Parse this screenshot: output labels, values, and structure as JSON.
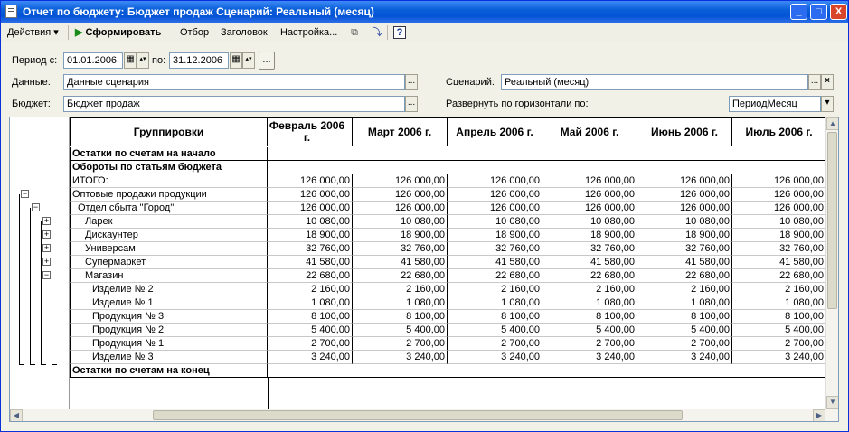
{
  "window": {
    "title": "Отчет по бюджету: Бюджет продаж Сценарий: Реальный (месяц)",
    "minimize": "_",
    "maximize": "□",
    "close": "X"
  },
  "toolbar": {
    "actions": "Действия",
    "generate": "Сформировать",
    "selection": "Отбор",
    "header": "Заголовок",
    "settings": "Настройка...",
    "help": "?"
  },
  "filters": {
    "period_from_label": "Период с:",
    "period_from": "01.01.2006",
    "period_to_label": "по:",
    "period_to": "31.12.2006",
    "period_button": "...",
    "data_label": "Данные:",
    "data_value": "Данные сценария",
    "scenario_label": "Сценарий:",
    "scenario_value": "Реальный (месяц)",
    "budget_label": "Бюджет:",
    "budget_value": "Бюджет продаж",
    "expand_label": "Развернуть по горизонтали по:",
    "expand_value": "ПериодМесяц",
    "ellipsis": "...",
    "clear": "×"
  },
  "report": {
    "columns": [
      "Группировки",
      "Февраль 2006 г.",
      "Март 2006 г.",
      "Апрель 2006 г.",
      "Май 2006 г.",
      "Июнь 2006 г.",
      "Июль 2006 г."
    ],
    "rows": [
      {
        "label": "Остатки по счетам на начало",
        "values": [
          "",
          "",
          "",
          "",
          "",
          ""
        ]
      },
      {
        "label": "Обороты по статьям бюджета",
        "values": [
          "",
          "",
          "",
          "",
          "",
          ""
        ]
      },
      {
        "label": "ИТОГО:",
        "values": [
          "126 000,00",
          "126 000,00",
          "126 000,00",
          "126 000,00",
          "126 000,00",
          "126 000,00"
        ]
      },
      {
        "label": "Оптовые продажи продукции",
        "values": [
          "126 000,00",
          "126 000,00",
          "126 000,00",
          "126 000,00",
          "126 000,00",
          "126 000,00"
        ]
      },
      {
        "label": "Отдел сбыта \"Город\"",
        "values": [
          "126 000,00",
          "126 000,00",
          "126 000,00",
          "126 000,00",
          "126 000,00",
          "126 000,00"
        ]
      },
      {
        "label": "Ларек",
        "values": [
          "10 080,00",
          "10 080,00",
          "10 080,00",
          "10 080,00",
          "10 080,00",
          "10 080,00"
        ]
      },
      {
        "label": "Дискаунтер",
        "values": [
          "18 900,00",
          "18 900,00",
          "18 900,00",
          "18 900,00",
          "18 900,00",
          "18 900,00"
        ]
      },
      {
        "label": "Универсам",
        "values": [
          "32 760,00",
          "32 760,00",
          "32 760,00",
          "32 760,00",
          "32 760,00",
          "32 760,00"
        ]
      },
      {
        "label": "Супермаркет",
        "values": [
          "41 580,00",
          "41 580,00",
          "41 580,00",
          "41 580,00",
          "41 580,00",
          "41 580,00"
        ]
      },
      {
        "label": "Магазин",
        "values": [
          "22 680,00",
          "22 680,00",
          "22 680,00",
          "22 680,00",
          "22 680,00",
          "22 680,00"
        ]
      },
      {
        "label": "Изделие № 2",
        "values": [
          "2 160,00",
          "2 160,00",
          "2 160,00",
          "2 160,00",
          "2 160,00",
          "2 160,00"
        ]
      },
      {
        "label": "Изделие № 1",
        "values": [
          "1 080,00",
          "1 080,00",
          "1 080,00",
          "1 080,00",
          "1 080,00",
          "1 080,00"
        ]
      },
      {
        "label": "Продукция № 3",
        "values": [
          "8 100,00",
          "8 100,00",
          "8 100,00",
          "8 100,00",
          "8 100,00",
          "8 100,00"
        ]
      },
      {
        "label": "Продукция № 2",
        "values": [
          "5 400,00",
          "5 400,00",
          "5 400,00",
          "5 400,00",
          "5 400,00",
          "5 400,00"
        ]
      },
      {
        "label": "Продукция № 1",
        "values": [
          "2 700,00",
          "2 700,00",
          "2 700,00",
          "2 700,00",
          "2 700,00",
          "2 700,00"
        ]
      },
      {
        "label": "Изделие № 3",
        "values": [
          "3 240,00",
          "3 240,00",
          "3 240,00",
          "3 240,00",
          "3 240,00",
          "3 240,00"
        ]
      },
      {
        "label": "Остатки по счетам на конец",
        "values": [
          "",
          "",
          "",
          "",
          "",
          ""
        ]
      }
    ]
  }
}
